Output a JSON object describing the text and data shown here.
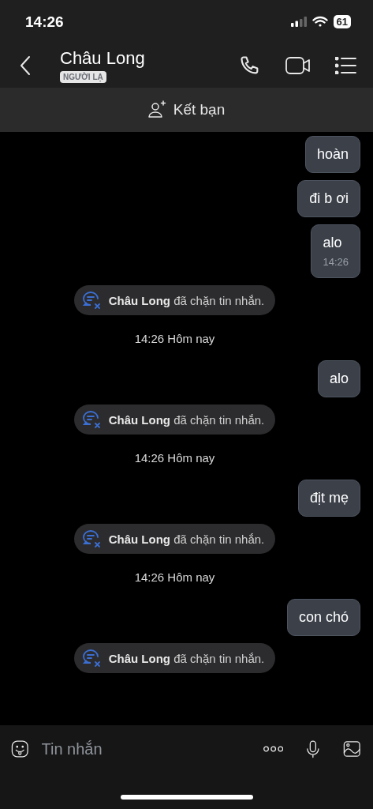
{
  "status_bar": {
    "time": "14:26",
    "battery": "61"
  },
  "header": {
    "name": "Châu Long",
    "badge": "NGƯỜI LẠ"
  },
  "friend_bar": {
    "label": "Kết bạn"
  },
  "messages": [
    {
      "kind": "outgoing",
      "text": "hoàn"
    },
    {
      "kind": "outgoing",
      "text": "đi b ơi"
    },
    {
      "kind": "outgoing",
      "text": "alo",
      "time": "14:26"
    },
    {
      "kind": "notice",
      "text": "**Châu Long** đã chặn tin nhắn."
    },
    {
      "kind": "divider",
      "text": "14:26 Hôm nay"
    },
    {
      "kind": "outgoing",
      "text": "alo"
    },
    {
      "kind": "notice",
      "text": "**Châu Long** đã chặn tin nhắn."
    },
    {
      "kind": "divider",
      "text": "14:26 Hôm nay"
    },
    {
      "kind": "outgoing",
      "text": "địt mẹ"
    },
    {
      "kind": "notice",
      "text": "**Châu Long** đã chặn tin nhắn."
    },
    {
      "kind": "divider",
      "text": "14:26 Hôm nay"
    },
    {
      "kind": "outgoing",
      "text": "con chó"
    },
    {
      "kind": "notice",
      "text": "**Châu Long** đã chặn tin nhắn."
    }
  ],
  "composer": {
    "placeholder": "Tin nhắn"
  }
}
